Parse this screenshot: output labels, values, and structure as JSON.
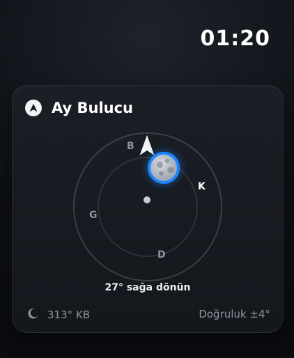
{
  "status": {
    "time": "01:20"
  },
  "card": {
    "title": "Ay Bulucu",
    "icon": "navigation-arrow-icon",
    "compass": {
      "north": "B",
      "east": "K",
      "south": "D",
      "west": "G",
      "target": "moon-icon"
    },
    "instruction": "27° sağa dönün",
    "azimuth": "313° KB",
    "accuracy": "Doğruluk ±4°"
  },
  "colors": {
    "accent": "#1b86ff",
    "background": "#0f1116",
    "card": "#1b1e25",
    "muted_text": "#8e939c"
  }
}
